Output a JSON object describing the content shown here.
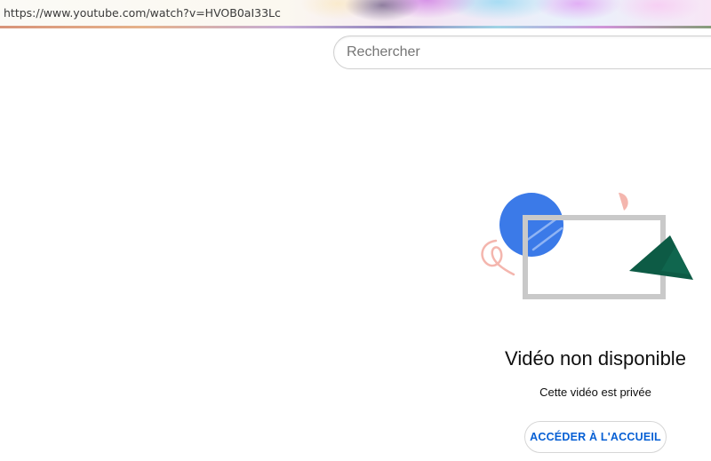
{
  "browser": {
    "url": "https://www.youtube.com/watch?v=HVOB0aI33Lc"
  },
  "search": {
    "placeholder": "Rechercher"
  },
  "error": {
    "title": "Vidéo non disponible",
    "message": "Cette vidéo est privée",
    "home_button_label": "ACCÉDER À L'ACCUEIL"
  },
  "illustration": {
    "icon": "video-unavailable-illustration",
    "colors": {
      "circle": "#3b7ae8",
      "frame": "#c9c9c9",
      "triangle": "#0d5b45",
      "accent": "#f4b6ae"
    }
  },
  "colors": {
    "link_blue": "#065fd4",
    "text": "#0f0f0f"
  }
}
